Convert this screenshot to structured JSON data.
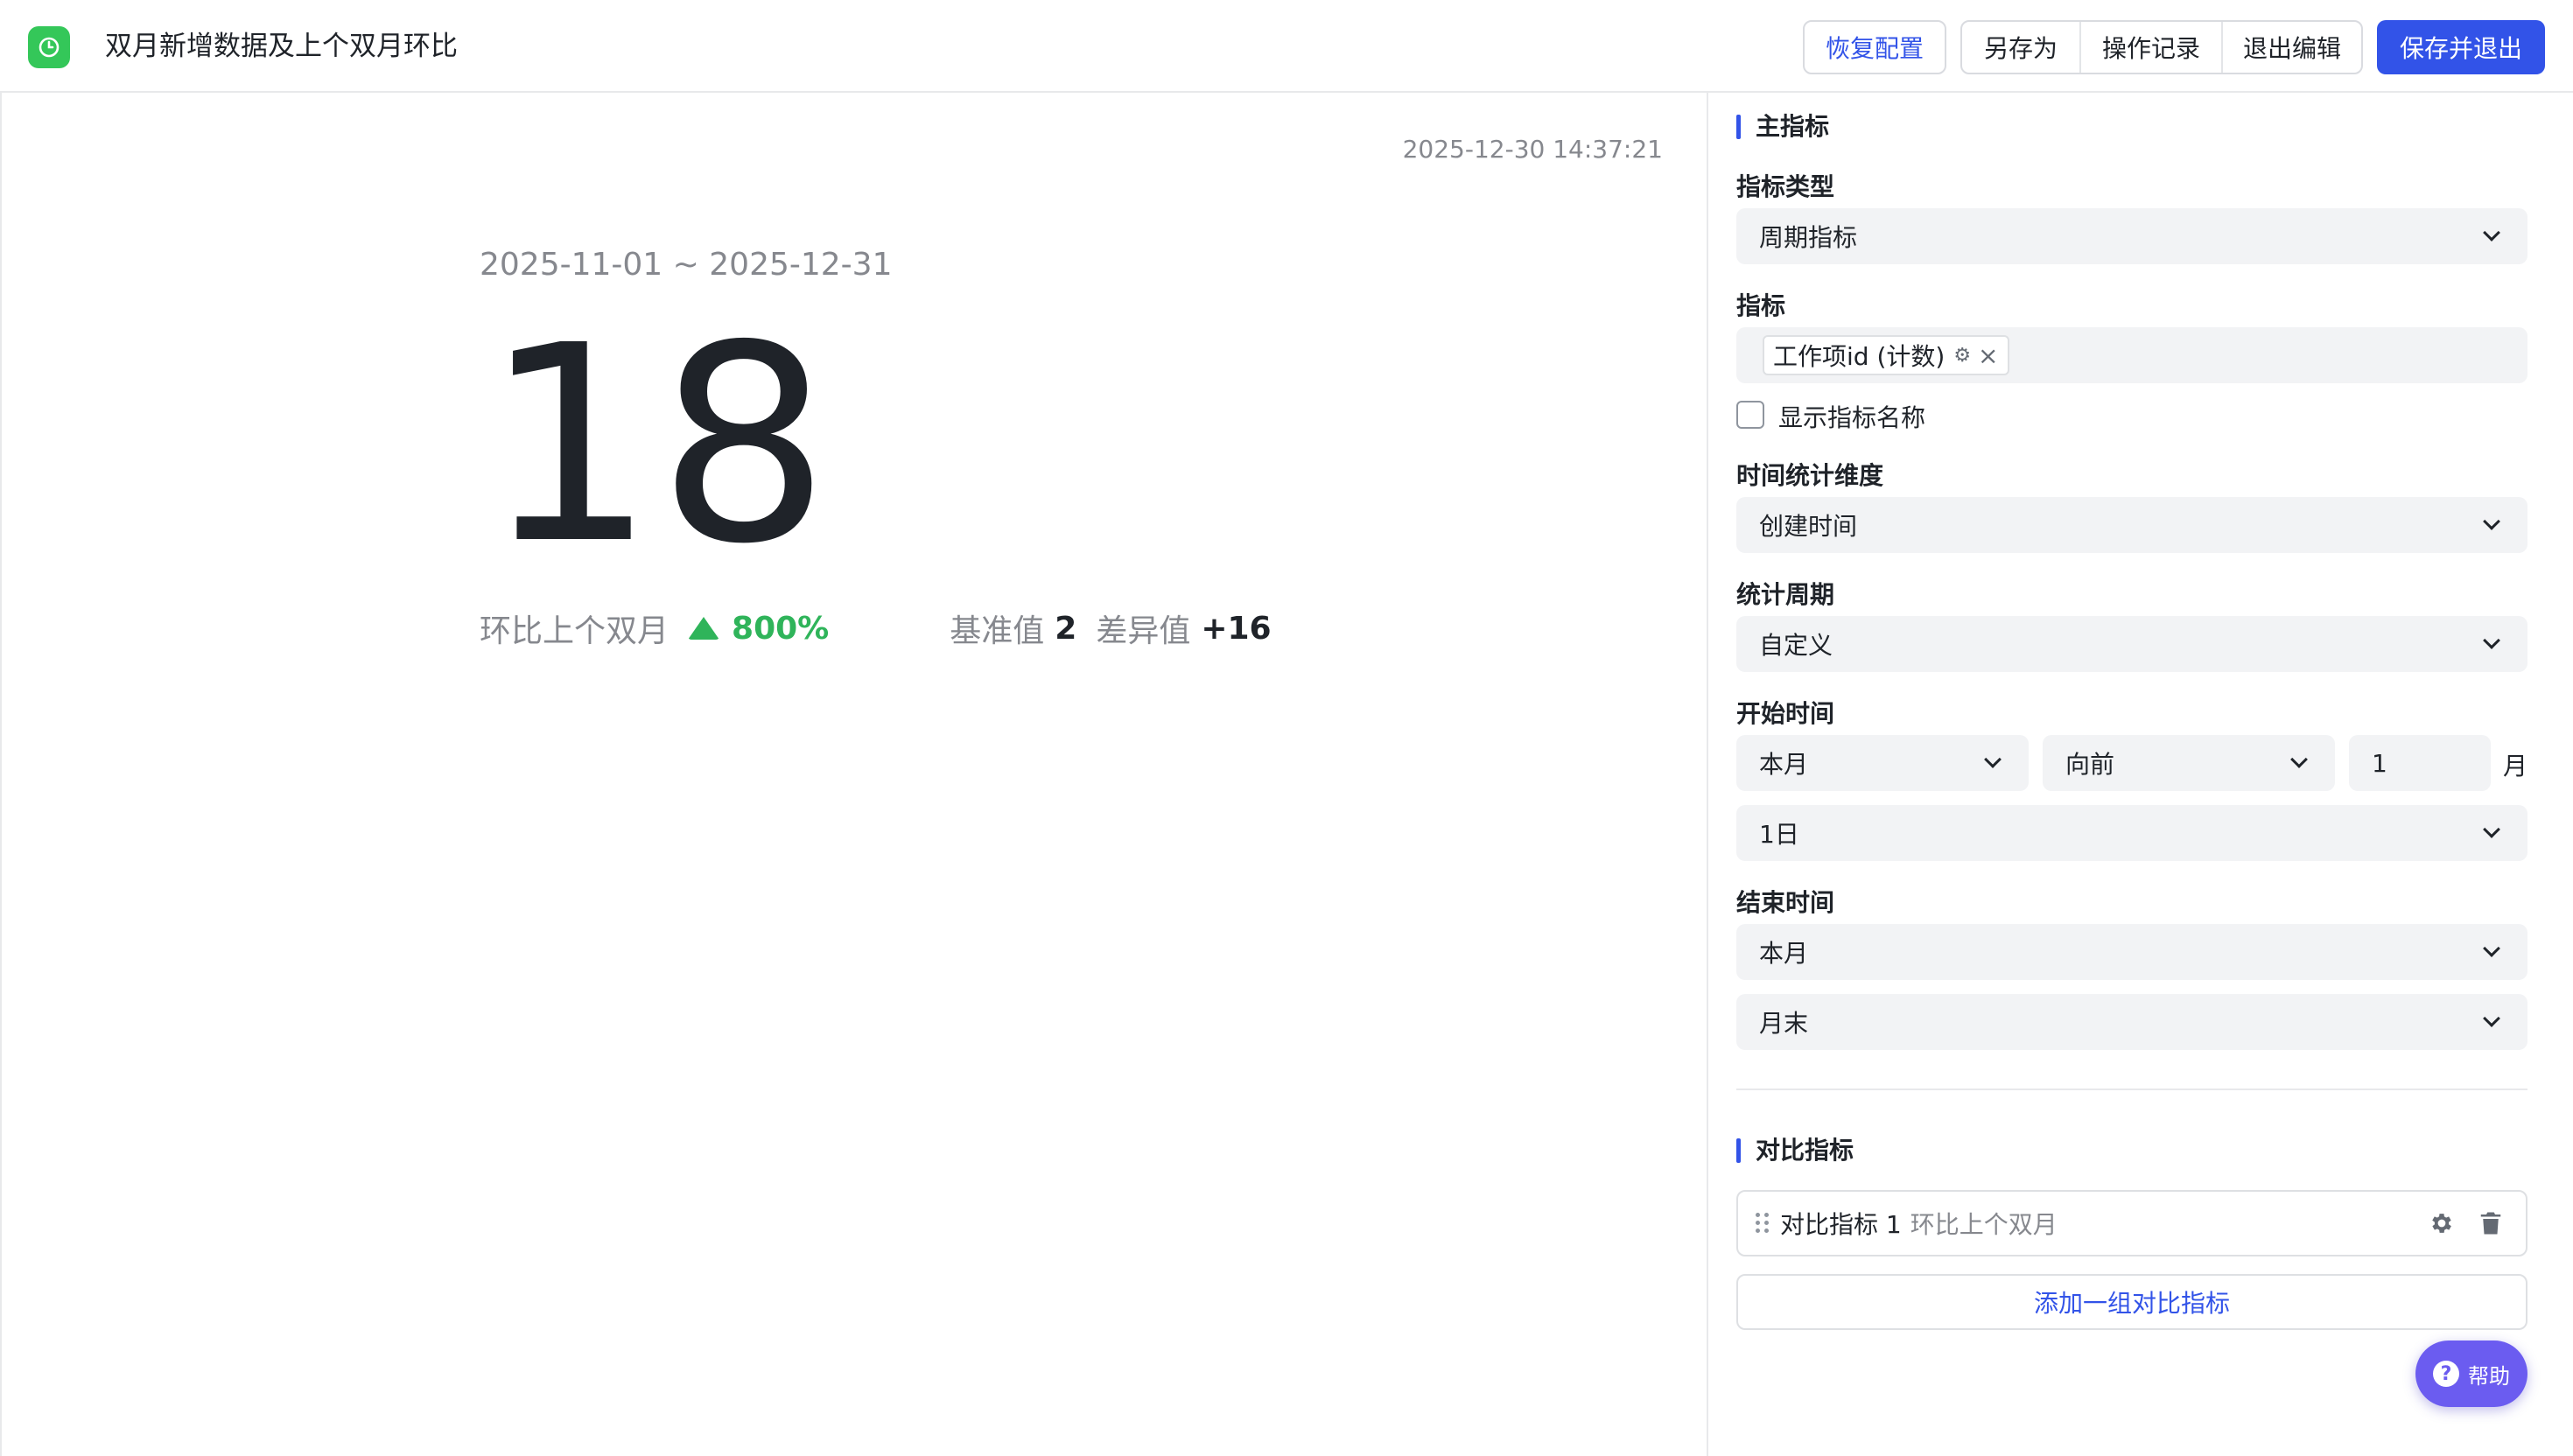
{
  "header": {
    "title": "双月新增数据及上个双月环比",
    "restore_label": "恢复配置",
    "save_as_label": "另存为",
    "history_label": "操作记录",
    "exit_edit_label": "退出编辑",
    "save_exit_label": "保存并退出",
    "app_icon": "clock-icon",
    "accent_color": "#3253e8",
    "app_icon_color": "#34c759"
  },
  "canvas": {
    "timestamp": "2025-12-30 14:37:21",
    "date_range": "2025-11-01 ~ 2025-12-31",
    "value": "18",
    "compare_label": "环比上个双月",
    "change_pct": "800%",
    "trend": "up",
    "trend_color": "#2fb45a",
    "base_label": "基准值",
    "base_value": "2",
    "diff_label": "差异值",
    "diff_value": "+16"
  },
  "panel": {
    "main_section_title": "主指标",
    "metric_type_label": "指标类型",
    "metric_type_value": "周期指标",
    "metric_label": "指标",
    "metric_tag": "工作项id (计数)",
    "show_name_label": "显示指标名称",
    "show_name_checked": false,
    "time_dim_label": "时间统计维度",
    "time_dim_value": "创建时间",
    "period_label": "统计周期",
    "period_value": "自定义",
    "start_label": "开始时间",
    "start_anchor": "本月",
    "start_direction": "向前",
    "start_offset": "1",
    "start_unit": "月",
    "start_day": "1日",
    "end_label": "结束时间",
    "end_anchor": "本月",
    "end_day": "月末",
    "compare_section_title": "对比指标",
    "compare_item_name": "对比指标 1",
    "compare_item_desc": "环比上个双月",
    "add_compare_label": "添加一组对比指标"
  },
  "help": {
    "label": "帮助"
  }
}
